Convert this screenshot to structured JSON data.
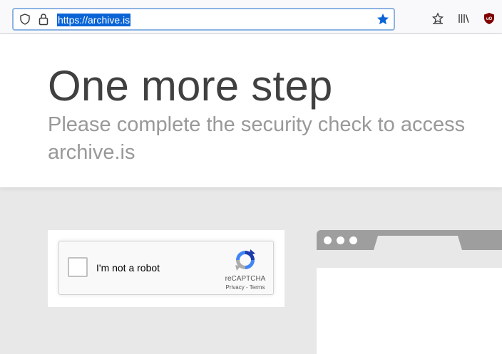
{
  "browser": {
    "url": "https://archive.is",
    "icons": {
      "tracking_protection": "shield-icon",
      "security": "lock-icon",
      "bookmark": "star-icon",
      "pocket": "pocket-icon",
      "library": "library-icon",
      "extension": "ublock-origin-icon"
    },
    "colors": {
      "bookmark_star": "#0a64d6",
      "url_selection": "#0a64d6",
      "ublock": "#800000"
    }
  },
  "page": {
    "title": "One more step",
    "subtitle": "Please complete the security check to access archive.is"
  },
  "captcha": {
    "label": "I'm not a robot",
    "brand": "reCAPTCHA",
    "privacy_link": "Privacy",
    "separator": " - ",
    "terms_link": "Terms",
    "checked": false
  },
  "illustration": {
    "icon": "browser-window-illustration"
  }
}
